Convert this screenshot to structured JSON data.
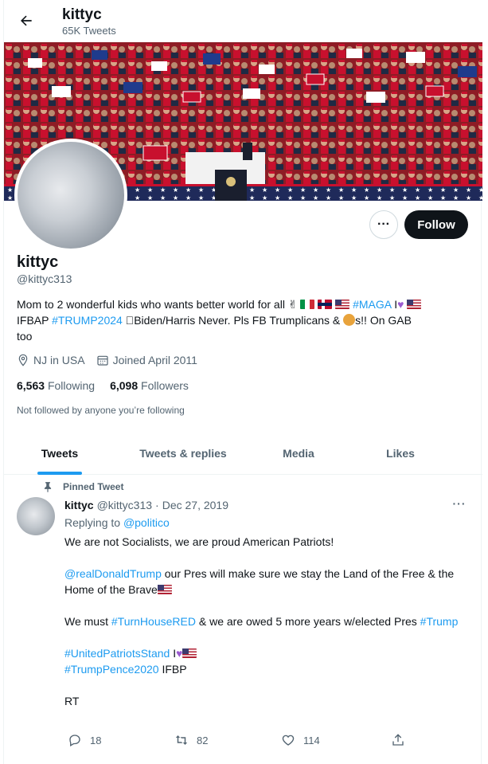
{
  "header": {
    "title": "kittyc",
    "tweet_count": "65K Tweets"
  },
  "profile": {
    "name": "kittyc",
    "handle": "@kittyc313",
    "follow_label": "Follow",
    "more_label": "···",
    "bio": {
      "part1": "Mom to 2 wonderful kids who wants better world for all ",
      "hashtag1": "#MAGA",
      "part2": " I",
      "part3": "IFBAP ",
      "hashtag2": "#TRUMP2024",
      "part4": "Biden/Harris Never. Pls FB Trumplicans & ",
      "part5": "s!! On GAB",
      "part6": "too"
    },
    "location": "NJ in USA",
    "joined": "Joined April 2011",
    "following_count": "6,563",
    "following_label": "Following",
    "followers_count": "6,098",
    "followers_label": "Followers",
    "not_followed": "Not followed by anyone you’re following"
  },
  "tabs": [
    {
      "label": "Tweets",
      "active": true
    },
    {
      "label": "Tweets & replies",
      "active": false
    },
    {
      "label": "Media",
      "active": false
    },
    {
      "label": "Likes",
      "active": false
    }
  ],
  "tweet": {
    "pinned_label": "Pinned Tweet",
    "author": "kittyc",
    "handle": "@kittyc313",
    "separator": "·",
    "date": "Dec 27, 2019",
    "replying_to_label": "Replying to ",
    "replying_to": "@politico",
    "line1": "We are not Socialists, we are proud American Patriots!",
    "mention": "@realDonaldTrump",
    "line2": " our Pres will make sure we stay the Land of the Free & the Home of the Brave",
    "line3a": "We must ",
    "hashtag_a": "#TurnHouseRED",
    "line3b": " & we are owed 5 more years w/elected Pres ",
    "hashtag_b": "#Trump",
    "hashtag_c": "#UnitedPatriotsStand",
    "hashtag_c_suffix": "  I",
    "hashtag_d": "#TrumpPence2020",
    "hashtag_d_suffix": "  IFBP",
    "line_rt": "RT",
    "replies": "18",
    "retweets": "82",
    "likes": "114"
  },
  "icons": {
    "back": "arrow-left-icon",
    "location": "location-pin-icon",
    "calendar": "calendar-icon",
    "pin": "pin-icon",
    "reply": "reply-icon",
    "retweet": "retweet-icon",
    "like": "heart-icon",
    "share": "share-icon"
  },
  "colors": {
    "accent": "#1d9bf0",
    "text": "#0f1419",
    "muted": "#536471",
    "banner": "#c8102e"
  }
}
